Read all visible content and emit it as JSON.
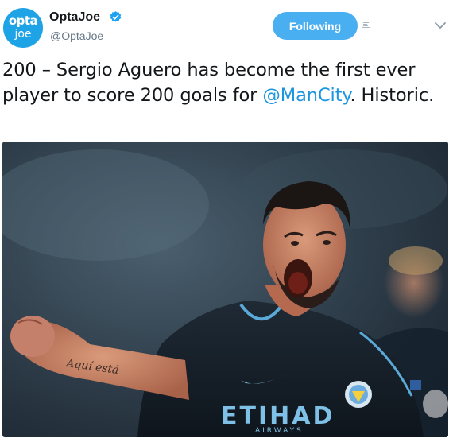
{
  "account": {
    "avatar_line1": "opta",
    "avatar_line2": "joe",
    "display_name": "OptaJoe",
    "username": "@OptaJoe",
    "verified": true
  },
  "actions": {
    "follow_label": "Following",
    "caret_icon": "chevron-down-icon",
    "small_icon": "translate-icon"
  },
  "tweet": {
    "text_before": "200 – Sergio Aguero has become the first ever player to score 200 goals for ",
    "mention": "@ManCity",
    "text_after": ". Historic."
  },
  "photo": {
    "tattoo_text": "Aquí está"
  },
  "colors": {
    "brand_blue": "#1ea3e6",
    "follow_button": "#4aaff0",
    "link": "#1b95e0",
    "secondary_text": "#657786"
  }
}
